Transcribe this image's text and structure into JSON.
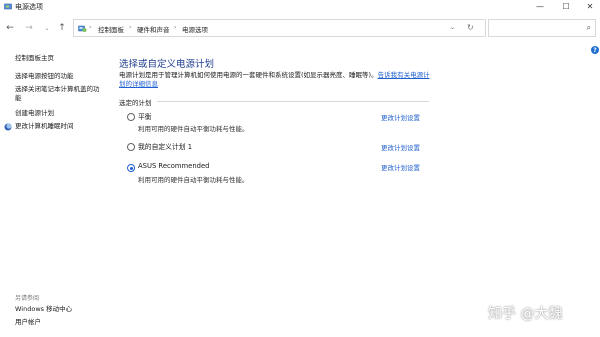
{
  "window": {
    "title": "电源选项",
    "min_glyph": "—",
    "max_glyph": "☐",
    "close_glyph": "✕"
  },
  "nav": {
    "back_glyph": "←",
    "forward_glyph": "→",
    "dropdown_glyph": "⌄",
    "up_glyph": "↑",
    "breadcrumb": [
      "控制面板",
      "硬件和声音",
      "电源选项"
    ],
    "separator_glyph": "›",
    "address_dropdown_glyph": "⌄",
    "refresh_glyph": "↻",
    "search_placeholder": "",
    "search_glyph": "⌕"
  },
  "help": {
    "glyph": "?"
  },
  "sidebar": {
    "home": "控制面板主页",
    "items": [
      {
        "label": "选择电源按钮的功能"
      },
      {
        "label": "选择关闭笔记本计算机盖的功"
      },
      {
        "label": "能"
      },
      {
        "label": "创建电源计划"
      },
      {
        "label": "更改计算机睡眠时间"
      }
    ],
    "see_also_title": "另请参阅",
    "see_also": [
      {
        "label": "Windows 移动中心"
      },
      {
        "label": "用户帐户"
      }
    ]
  },
  "main": {
    "title": "选择或自定义电源计划",
    "description": "电源计划是用于管理计算机如何使用电源的一套硬件和系统设置(如显示器亮度、睡眠等)。",
    "description_link_1": "告诉我有关电源计",
    "description_link_2": "划的详细信息",
    "section_label": "选定的计划",
    "plans": [
      {
        "name": "平衡",
        "desc": "利用可用的硬件自动平衡功耗与性能。",
        "selected": false,
        "change": "更改计划设置"
      },
      {
        "name": "我的自定义计划 1",
        "desc": "",
        "selected": false,
        "change": "更改计划设置"
      },
      {
        "name": "ASUS Recommended",
        "desc": "利用可用的硬件自动平衡功耗与性能。",
        "selected": true,
        "change": "更改计划设置"
      }
    ]
  },
  "watermark": "知乎 @大魏",
  "colors": {
    "link": "#1f5fcf",
    "title": "#1f3f8f",
    "help_badge": "#1f6fd1"
  }
}
